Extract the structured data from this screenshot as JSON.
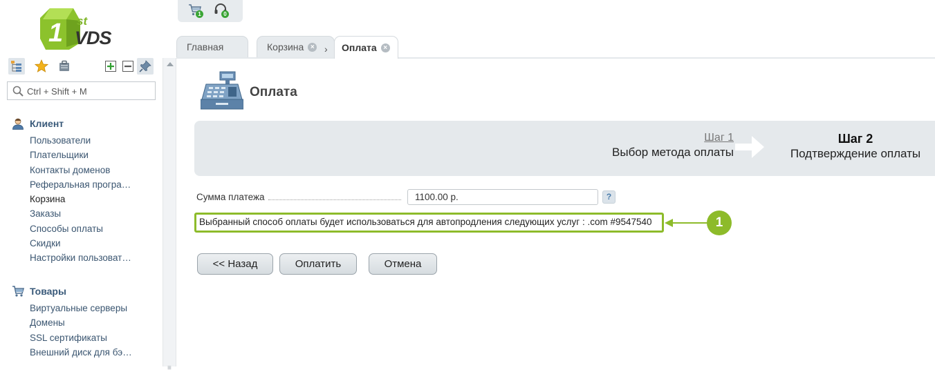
{
  "app": {
    "logo_text": "VDS",
    "logo_sup": "st"
  },
  "top_tools": {
    "cart_count": "1",
    "support_count": "0"
  },
  "search": {
    "placeholder": "Ctrl + Shift + M"
  },
  "nav": {
    "groups": [
      {
        "title": "Клиент",
        "items": [
          "Пользователи",
          "Плательщики",
          "Контакты доменов",
          "Реферальная програ…",
          "Корзина",
          "Заказы",
          "Способы оплаты",
          "Скидки",
          "Настройки пользоват…"
        ]
      },
      {
        "title": "Товары",
        "items": [
          "Виртуальные серверы",
          "Домены",
          "SSL сертификаты",
          "Внешний диск для бэ…"
        ]
      }
    ]
  },
  "tabs": [
    {
      "label": "Главная"
    },
    {
      "label": "Корзина"
    },
    {
      "label": "Оплата"
    }
  ],
  "page": {
    "title": "Оплата",
    "steps": {
      "step1_num": "Шаг 1",
      "step1_desc": "Выбор метода оплаты",
      "step2_num": "Шаг 2",
      "step2_desc": "Подтверждение оплаты"
    },
    "amount_label": "Сумма платежа",
    "amount_value": "1100.00 р.",
    "help_label": "?",
    "notice": "Выбранный способ оплаты будет использоваться для автопродления следующих услуг : .com #9547540",
    "callout_number": "1",
    "buttons": {
      "back": "<< Назад",
      "pay": "Оплатить",
      "cancel": "Отмена"
    }
  },
  "colors": {
    "accent_green": "#8dbb2a",
    "nav_link": "#3a5570",
    "panel_bg": "#e5e9ec"
  }
}
